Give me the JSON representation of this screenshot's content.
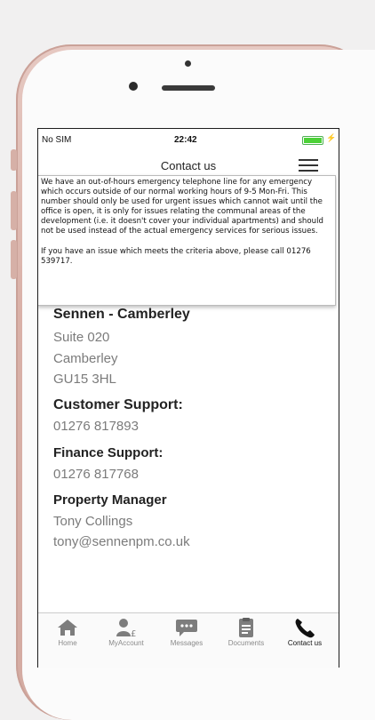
{
  "status_bar": {
    "carrier": "No SIM",
    "time": "22:42"
  },
  "header": {
    "title": "Contact us",
    "menu_icon": "hamburger-menu-icon"
  },
  "notice": {
    "paragraph1": "We have an out-of-hours emergency telephone line for any emergency which occurs outside of our normal working hours of 9-5 Mon-Fri. This number should only be used for urgent issues which cannot wait until the office is open, it is only for issues relating the communal areas of the development (i.e. it doesn't cover your individual apartments) and should not be used instead of the actual emergency services for serious issues.",
    "paragraph2": "If you have an issue which meets the criteria above, please call 01276 539717."
  },
  "contact": {
    "company": "Sennen - Camberley",
    "address": [
      "Suite 020",
      "Camberley",
      "GU15 3HL"
    ],
    "customer_support": {
      "label": "Customer Support:",
      "phone": "01276 817893"
    },
    "finance_support": {
      "label": "Finance Support:",
      "phone": "01276 817768"
    },
    "property_manager": {
      "label": "Property Manager",
      "name": "Tony Collings",
      "email": "tony@sennenpm.co.uk"
    }
  },
  "tabs": [
    {
      "label": "Home",
      "icon": "home-icon"
    },
    {
      "label": "MyAccount",
      "icon": "account-pound-icon"
    },
    {
      "label": "Messages",
      "icon": "chat-icon"
    },
    {
      "label": "Documents",
      "icon": "document-icon"
    },
    {
      "label": "Contact us",
      "icon": "phone-icon",
      "active": true
    }
  ],
  "colors": {
    "battery": "#4cd137",
    "frame": "#d9b1a8",
    "active_tab": "#111111",
    "inactive_tab": "#8a8a8a"
  }
}
